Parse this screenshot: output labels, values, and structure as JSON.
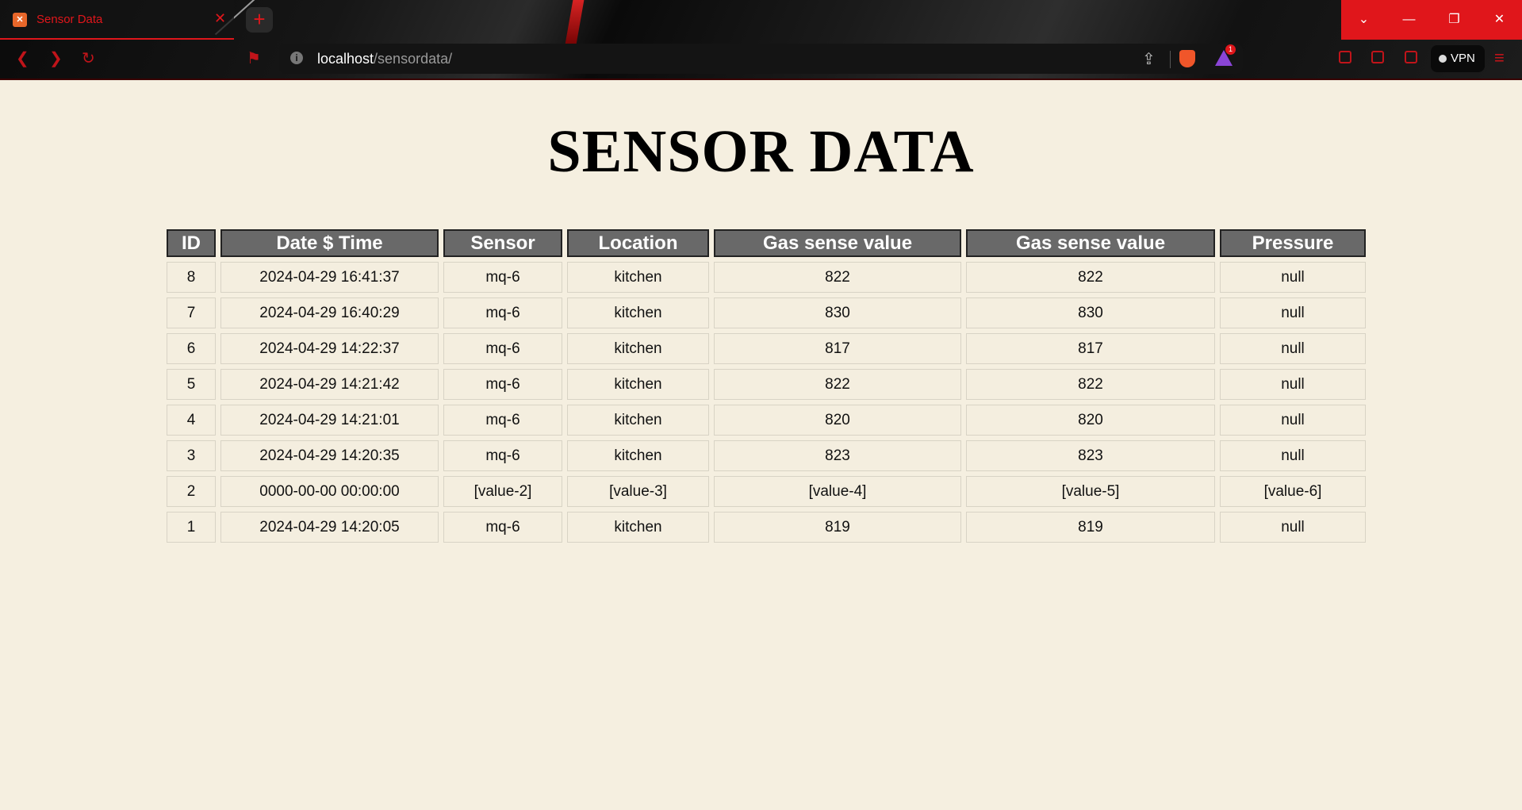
{
  "browser": {
    "tab_title": "Sensor Data",
    "tab_icon": "xampp-favicon-icon",
    "new_tab_label": "+",
    "address_host": "localhost",
    "address_path": "/sensordata/",
    "rewards_badge": "1",
    "vpn_label": "VPN",
    "accent_color": "#e0161b"
  },
  "page": {
    "title": "SENSOR DATA"
  },
  "table": {
    "headers": [
      "ID",
      "Date $ Time",
      "Sensor",
      "Location",
      "Gas sense value",
      "Gas sense value",
      "Pressure"
    ],
    "rows": [
      [
        "8",
        "2024-04-29 16:41:37",
        "mq-6",
        "kitchen",
        "822",
        "822",
        "null"
      ],
      [
        "7",
        "2024-04-29 16:40:29",
        "mq-6",
        "kitchen",
        "830",
        "830",
        "null"
      ],
      [
        "6",
        "2024-04-29 14:22:37",
        "mq-6",
        "kitchen",
        "817",
        "817",
        "null"
      ],
      [
        "5",
        "2024-04-29 14:21:42",
        "mq-6",
        "kitchen",
        "822",
        "822",
        "null"
      ],
      [
        "4",
        "2024-04-29 14:21:01",
        "mq-6",
        "kitchen",
        "820",
        "820",
        "null"
      ],
      [
        "3",
        "2024-04-29 14:20:35",
        "mq-6",
        "kitchen",
        "823",
        "823",
        "null"
      ],
      [
        "2",
        "0000-00-00 00:00:00",
        "[value-2]",
        "[value-3]",
        "[value-4]",
        "[value-5]",
        "[value-6]"
      ],
      [
        "1",
        "2024-04-29 14:20:05",
        "mq-6",
        "kitchen",
        "819",
        "819",
        "null"
      ]
    ]
  }
}
